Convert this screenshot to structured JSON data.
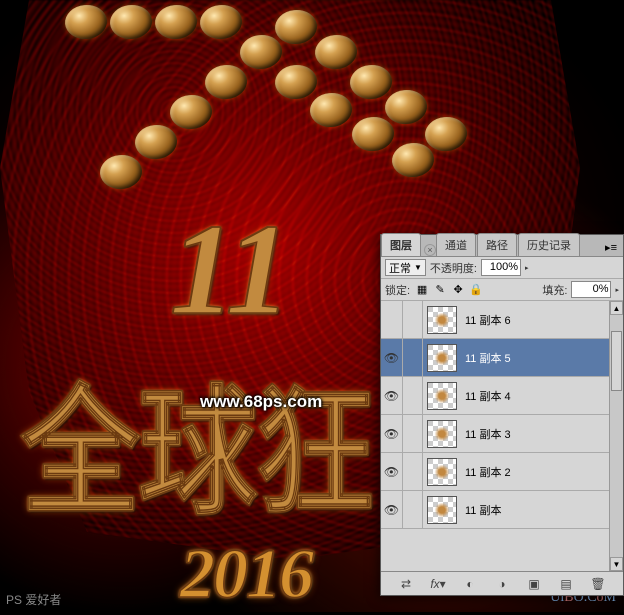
{
  "artwork": {
    "number": "11",
    "subtitle": "全球狂",
    "year": "2016"
  },
  "watermarks": {
    "center": "www.68ps.com",
    "bottom_right_a": "Ui",
    "bottom_right_b": "B",
    "bottom_right_c": "O.C",
    "bottom_right_d": "o",
    "bottom_right_e": "M",
    "bottom_left": "PS 爱好者"
  },
  "panel": {
    "tabs": [
      "图层",
      "通道",
      "路径",
      "历史记录"
    ],
    "active_tab": 0,
    "blend_mode": "正常",
    "opacity_label": "不透明度:",
    "opacity_value": "100%",
    "lock_label": "锁定:",
    "fill_label": "填充:",
    "fill_value": "0%",
    "layers": [
      {
        "visible": false,
        "name": "11 副本 6",
        "selected": false
      },
      {
        "visible": true,
        "name": "11 副本 5",
        "selected": true
      },
      {
        "visible": true,
        "name": "11 副本 4",
        "selected": false
      },
      {
        "visible": true,
        "name": "11 副本 3",
        "selected": false
      },
      {
        "visible": true,
        "name": "11 副本 2",
        "selected": false
      },
      {
        "visible": true,
        "name": "11 副本",
        "selected": false
      }
    ],
    "footer_icons": [
      "link-icon",
      "fx-icon",
      "mask-icon",
      "adjustment-icon",
      "group-icon",
      "new-layer-icon",
      "trash-icon"
    ]
  }
}
